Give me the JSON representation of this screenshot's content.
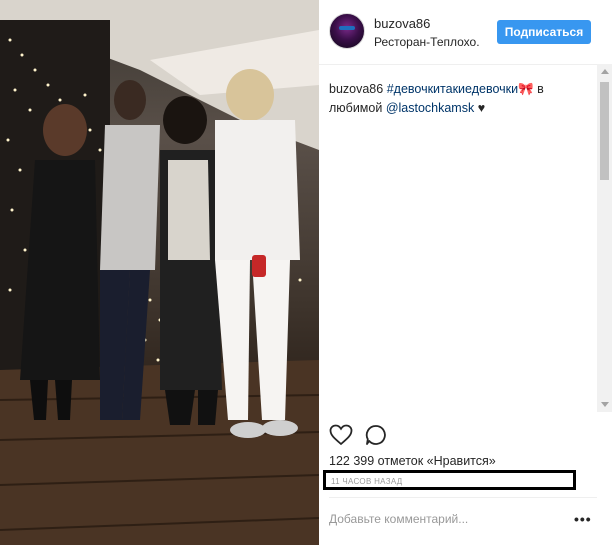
{
  "post": {
    "username": "buzova86",
    "location": "Ресторан-Теплохо...",
    "follow_label": "Подписаться",
    "caption": {
      "username": "buzova86",
      "hashtag": "#девочкитакиедевочки🎀",
      "text_before_mention": " в любимой ",
      "mention": "@lastochkamsk",
      "text_after": " ♥"
    },
    "likes": "122 399 отметок «Нравится»",
    "time": "11 ЧАСОВ НАЗАД",
    "comment_placeholder": "Добавьте комментарий...",
    "more_label": "•••"
  },
  "icons": [
    "like-heart-icon",
    "comment-icon",
    "more-options-icon"
  ],
  "colors": {
    "follow_button": "#3897f0",
    "link": "#003569",
    "time_box_border": "#000000"
  }
}
